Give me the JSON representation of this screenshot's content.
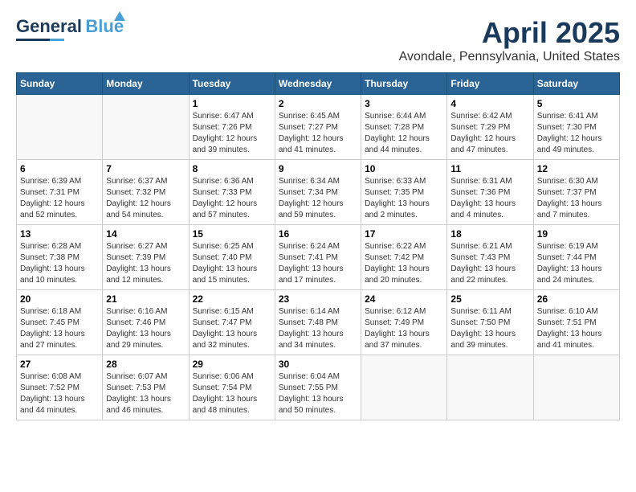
{
  "header": {
    "logo_line1": "General",
    "logo_line2": "Blue",
    "month": "April 2025",
    "location": "Avondale, Pennsylvania, United States"
  },
  "weekdays": [
    "Sunday",
    "Monday",
    "Tuesday",
    "Wednesday",
    "Thursday",
    "Friday",
    "Saturday"
  ],
  "weeks": [
    [
      {
        "day": "",
        "info": ""
      },
      {
        "day": "",
        "info": ""
      },
      {
        "day": "1",
        "info": "Sunrise: 6:47 AM\nSunset: 7:26 PM\nDaylight: 12 hours\nand 39 minutes."
      },
      {
        "day": "2",
        "info": "Sunrise: 6:45 AM\nSunset: 7:27 PM\nDaylight: 12 hours\nand 41 minutes."
      },
      {
        "day": "3",
        "info": "Sunrise: 6:44 AM\nSunset: 7:28 PM\nDaylight: 12 hours\nand 44 minutes."
      },
      {
        "day": "4",
        "info": "Sunrise: 6:42 AM\nSunset: 7:29 PM\nDaylight: 12 hours\nand 47 minutes."
      },
      {
        "day": "5",
        "info": "Sunrise: 6:41 AM\nSunset: 7:30 PM\nDaylight: 12 hours\nand 49 minutes."
      }
    ],
    [
      {
        "day": "6",
        "info": "Sunrise: 6:39 AM\nSunset: 7:31 PM\nDaylight: 12 hours\nand 52 minutes."
      },
      {
        "day": "7",
        "info": "Sunrise: 6:37 AM\nSunset: 7:32 PM\nDaylight: 12 hours\nand 54 minutes."
      },
      {
        "day": "8",
        "info": "Sunrise: 6:36 AM\nSunset: 7:33 PM\nDaylight: 12 hours\nand 57 minutes."
      },
      {
        "day": "9",
        "info": "Sunrise: 6:34 AM\nSunset: 7:34 PM\nDaylight: 12 hours\nand 59 minutes."
      },
      {
        "day": "10",
        "info": "Sunrise: 6:33 AM\nSunset: 7:35 PM\nDaylight: 13 hours\nand 2 minutes."
      },
      {
        "day": "11",
        "info": "Sunrise: 6:31 AM\nSunset: 7:36 PM\nDaylight: 13 hours\nand 4 minutes."
      },
      {
        "day": "12",
        "info": "Sunrise: 6:30 AM\nSunset: 7:37 PM\nDaylight: 13 hours\nand 7 minutes."
      }
    ],
    [
      {
        "day": "13",
        "info": "Sunrise: 6:28 AM\nSunset: 7:38 PM\nDaylight: 13 hours\nand 10 minutes."
      },
      {
        "day": "14",
        "info": "Sunrise: 6:27 AM\nSunset: 7:39 PM\nDaylight: 13 hours\nand 12 minutes."
      },
      {
        "day": "15",
        "info": "Sunrise: 6:25 AM\nSunset: 7:40 PM\nDaylight: 13 hours\nand 15 minutes."
      },
      {
        "day": "16",
        "info": "Sunrise: 6:24 AM\nSunset: 7:41 PM\nDaylight: 13 hours\nand 17 minutes."
      },
      {
        "day": "17",
        "info": "Sunrise: 6:22 AM\nSunset: 7:42 PM\nDaylight: 13 hours\nand 20 minutes."
      },
      {
        "day": "18",
        "info": "Sunrise: 6:21 AM\nSunset: 7:43 PM\nDaylight: 13 hours\nand 22 minutes."
      },
      {
        "day": "19",
        "info": "Sunrise: 6:19 AM\nSunset: 7:44 PM\nDaylight: 13 hours\nand 24 minutes."
      }
    ],
    [
      {
        "day": "20",
        "info": "Sunrise: 6:18 AM\nSunset: 7:45 PM\nDaylight: 13 hours\nand 27 minutes."
      },
      {
        "day": "21",
        "info": "Sunrise: 6:16 AM\nSunset: 7:46 PM\nDaylight: 13 hours\nand 29 minutes."
      },
      {
        "day": "22",
        "info": "Sunrise: 6:15 AM\nSunset: 7:47 PM\nDaylight: 13 hours\nand 32 minutes."
      },
      {
        "day": "23",
        "info": "Sunrise: 6:14 AM\nSunset: 7:48 PM\nDaylight: 13 hours\nand 34 minutes."
      },
      {
        "day": "24",
        "info": "Sunrise: 6:12 AM\nSunset: 7:49 PM\nDaylight: 13 hours\nand 37 minutes."
      },
      {
        "day": "25",
        "info": "Sunrise: 6:11 AM\nSunset: 7:50 PM\nDaylight: 13 hours\nand 39 minutes."
      },
      {
        "day": "26",
        "info": "Sunrise: 6:10 AM\nSunset: 7:51 PM\nDaylight: 13 hours\nand 41 minutes."
      }
    ],
    [
      {
        "day": "27",
        "info": "Sunrise: 6:08 AM\nSunset: 7:52 PM\nDaylight: 13 hours\nand 44 minutes."
      },
      {
        "day": "28",
        "info": "Sunrise: 6:07 AM\nSunset: 7:53 PM\nDaylight: 13 hours\nand 46 minutes."
      },
      {
        "day": "29",
        "info": "Sunrise: 6:06 AM\nSunset: 7:54 PM\nDaylight: 13 hours\nand 48 minutes."
      },
      {
        "day": "30",
        "info": "Sunrise: 6:04 AM\nSunset: 7:55 PM\nDaylight: 13 hours\nand 50 minutes."
      },
      {
        "day": "",
        "info": ""
      },
      {
        "day": "",
        "info": ""
      },
      {
        "day": "",
        "info": ""
      }
    ]
  ]
}
